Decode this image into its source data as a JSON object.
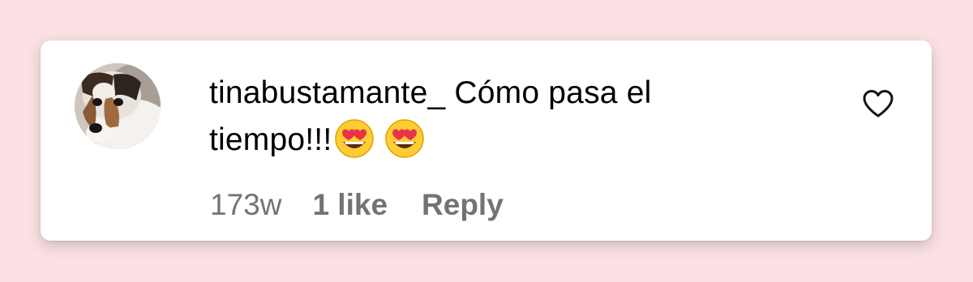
{
  "comment": {
    "username": "tinabustamante_",
    "text_line1": "Cómo pasa el",
    "text_line2": "tiempo!!!",
    "emojis": [
      "smiling-face-with-heart-eyes",
      "smiling-face-with-heart-eyes"
    ],
    "timestamp": "173w",
    "likes_label": "1 like",
    "reply_label": "Reply",
    "like_icon": "heart-outline-icon",
    "avatar": "dog-profile-photo"
  },
  "colors": {
    "page_background": "#fbe1e3",
    "card_background": "#ffffff",
    "text_primary": "#000000",
    "text_secondary": "#737373"
  }
}
